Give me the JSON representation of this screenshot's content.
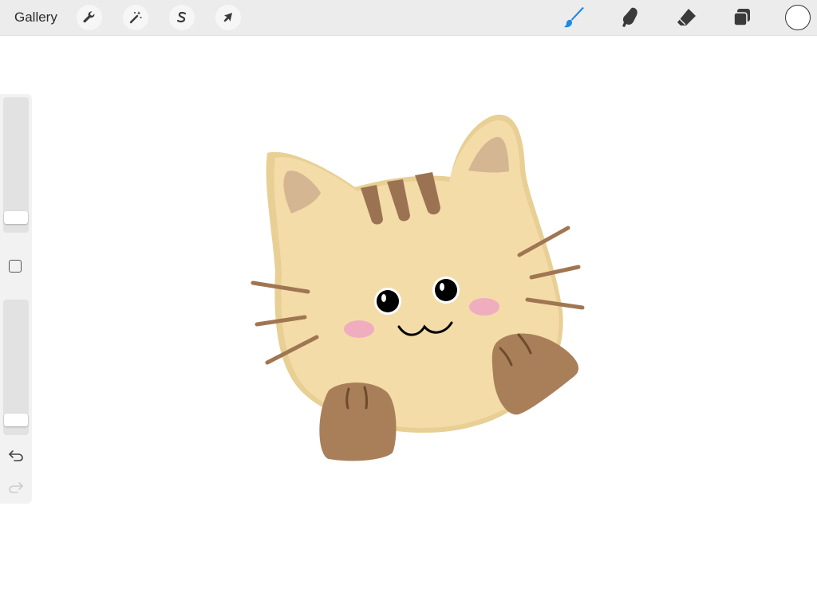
{
  "topbar": {
    "gallery_label": "Gallery",
    "left_tools": [
      "wrench-icon",
      "magic-wand-icon",
      "selection-icon",
      "transform-arrow-icon"
    ],
    "right_tools": [
      "brush-icon",
      "smudge-icon",
      "eraser-icon",
      "layers-icon"
    ],
    "active_tool": "brush-icon",
    "current_color": "#ffffff",
    "accent_color": "#1e88e5"
  },
  "sidebar": {
    "brush_size": 0.05,
    "opacity": 0.05,
    "modify_button_icon": "square-icon",
    "undo_icon": "undo-icon",
    "redo_icon": "redo-icon"
  },
  "canvas": {
    "artwork": "cat-drawing",
    "colors": {
      "body": "#f3dca8",
      "body_shadow": "#e8cf94",
      "inner_ear": "#d4b692",
      "stripes": "#9b7352",
      "whiskers": "#a07652",
      "paws": "#a97f5a",
      "blush": "#f0adc0",
      "eyes": "#000000"
    }
  }
}
